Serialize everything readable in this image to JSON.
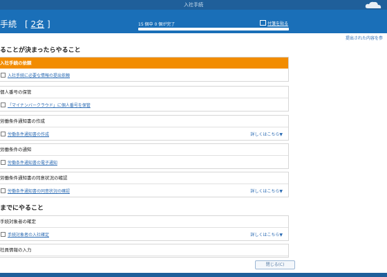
{
  "window": {
    "title": "入社手続"
  },
  "header": {
    "title": "手続",
    "count_prefix": "[",
    "count_num": "2名",
    "count_suffix": "]",
    "progress_text": "15 個中 0 個が完了",
    "progress_fraction": 0,
    "sticky_label": "付箋を貼る"
  },
  "top_link": "提出された内容を参",
  "sections": [
    {
      "heading": "ることが決まったらやること",
      "cards": [
        {
          "title": "入社手続の依頼",
          "highlight": true,
          "task": "入社手続に必要な情報の提出依頼",
          "more": ""
        },
        {
          "title": "個人番号の保管",
          "highlight": false,
          "task": "「マイナンバークラウド」に個人番号を保管",
          "more": ""
        },
        {
          "title": "労働条件通知書の作成",
          "highlight": false,
          "task": "労働条件通知書の作成",
          "more": "詳しくはこちら▼"
        },
        {
          "title": "労働条件の通知",
          "highlight": false,
          "task": "労働条件通知書の電子通知",
          "more": ""
        },
        {
          "title": "労働条件通知書の同意状況の確認",
          "highlight": false,
          "task": "労働条件通知書の同意状況の確認",
          "more": "詳しくはこちら▼"
        }
      ]
    },
    {
      "heading": "までにやること",
      "cards": [
        {
          "title": "手続対象者の確定",
          "highlight": false,
          "task": "手続対象者の入社確定",
          "more": "詳しくはこちら▼"
        },
        {
          "title": "社員情報の入力",
          "highlight": false,
          "task": "",
          "more": ""
        }
      ]
    }
  ],
  "close_button": "閉じる(C)",
  "colors": {
    "header": "#1a6fb8",
    "accent_orange": "#f28c00",
    "link": "#2a6ab3"
  }
}
